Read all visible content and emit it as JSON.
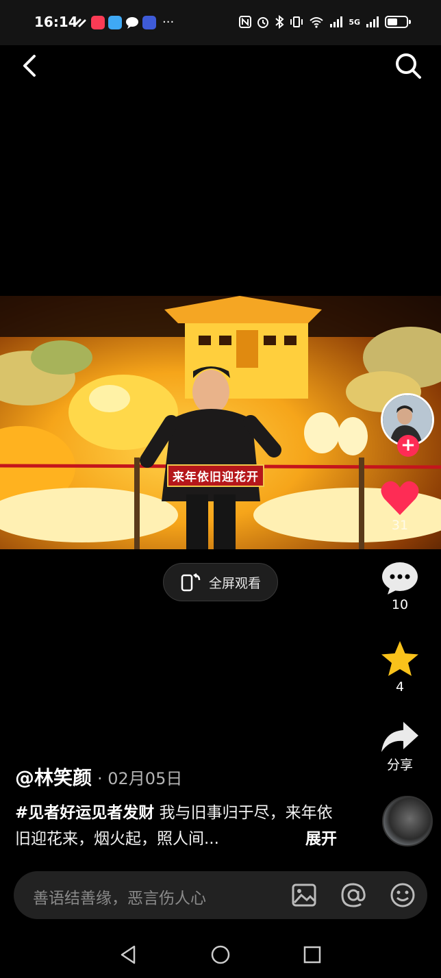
{
  "status_bar": {
    "time": "16:14",
    "more": "···",
    "network_label": "5G"
  },
  "video": {
    "subtitle": "来年依旧迎花开"
  },
  "fullscreen": {
    "label": "全屏观看"
  },
  "side_actions": {
    "like_count": "31",
    "comment_count": "10",
    "favorite_count": "4",
    "share_label": "分享"
  },
  "post": {
    "author": "@林笑颜",
    "date": "· 02月05日",
    "hashtag": "#见者好运见者发财",
    "caption": "我与旧事归于尽，来年依旧迎花来，烟火起，照人间...",
    "expand_label": "展开"
  },
  "comment_bar": {
    "placeholder": "善语结善缘，恶言伤人心"
  },
  "colors": {
    "like": "#fe2c55",
    "favorite": "#f9c21b",
    "background": "#000000"
  },
  "icons": [
    "back-icon",
    "search-icon",
    "fullscreen-icon",
    "heart-icon",
    "comment-icon",
    "star-icon",
    "share-icon",
    "image-icon",
    "at-icon",
    "emoji-icon"
  ]
}
